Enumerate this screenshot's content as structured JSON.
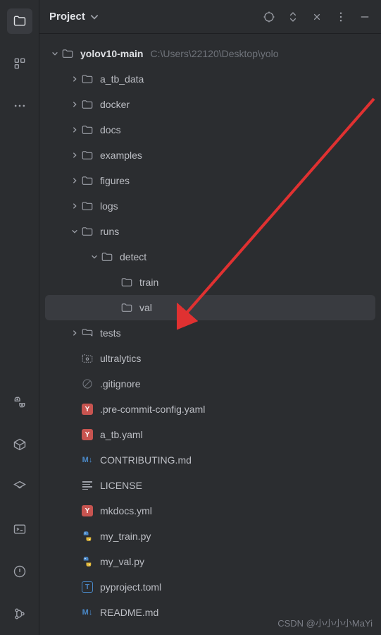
{
  "header": {
    "title": "Project"
  },
  "root": {
    "name": "yolov10-main",
    "path": "C:\\Users\\22120\\Desktop\\yolo"
  },
  "tree": {
    "a_tb_data": "a_tb_data",
    "docker": "docker",
    "docs": "docs",
    "examples": "examples",
    "figures": "figures",
    "logs": "logs",
    "runs": "runs",
    "detect": "detect",
    "train": "train",
    "val": "val",
    "tests": "tests",
    "ultralytics": "ultralytics",
    "gitignore": ".gitignore",
    "precommit": ".pre-commit-config.yaml",
    "a_tb_yaml": "a_tb.yaml",
    "contributing": "CONTRIBUTING.md",
    "license": "LICENSE",
    "mkdocs": "mkdocs.yml",
    "my_train": "my_train.py",
    "my_val": "my_val.py",
    "pyproject": "pyproject.toml",
    "readme": "README.md"
  },
  "icons": {
    "yaml_badge": "Y",
    "md_badge": "M↓",
    "toml_badge": "T"
  },
  "watermark": "CSDN @小小小小MaYi"
}
